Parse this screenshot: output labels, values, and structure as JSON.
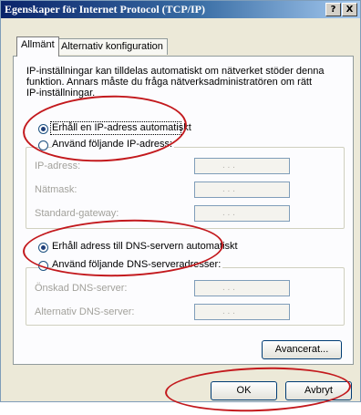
{
  "window": {
    "title": "Egenskaper för Internet Protocol (TCP/IP)"
  },
  "titlebar_buttons": {
    "help": "?",
    "close": "X"
  },
  "tabs": [
    {
      "label": "Allmänt",
      "active": true
    },
    {
      "label": "Alternativ konfiguration",
      "active": false
    }
  ],
  "description": "IP-inställningar kan tilldelas automatiskt om nätverket stöder denna funktion. Annars måste du fråga nätverksadministratören om rätt IP-inställningar.",
  "ip": {
    "auto_label": "Erhåll en IP-adress automatiskt",
    "auto_selected": true,
    "manual_label": "Använd följande IP-adress:",
    "fields": [
      {
        "label": "IP-adress:",
        "value": ". . ."
      },
      {
        "label": "Nätmask:",
        "value": ". . ."
      },
      {
        "label": "Standard-gateway:",
        "value": ". . ."
      }
    ]
  },
  "dns": {
    "auto_label": "Erhåll adress till DNS-servern automatiskt",
    "auto_selected": true,
    "manual_label": "Använd följande DNS-serveradresser:",
    "fields": [
      {
        "label": "Önskad DNS-server:",
        "value": ". . ."
      },
      {
        "label": "Alternativ DNS-server:",
        "value": ". . ."
      }
    ]
  },
  "buttons": {
    "advanced": "Avancerat...",
    "ok": "OK",
    "cancel": "Avbryt"
  },
  "annotation_color": "#c3191d"
}
